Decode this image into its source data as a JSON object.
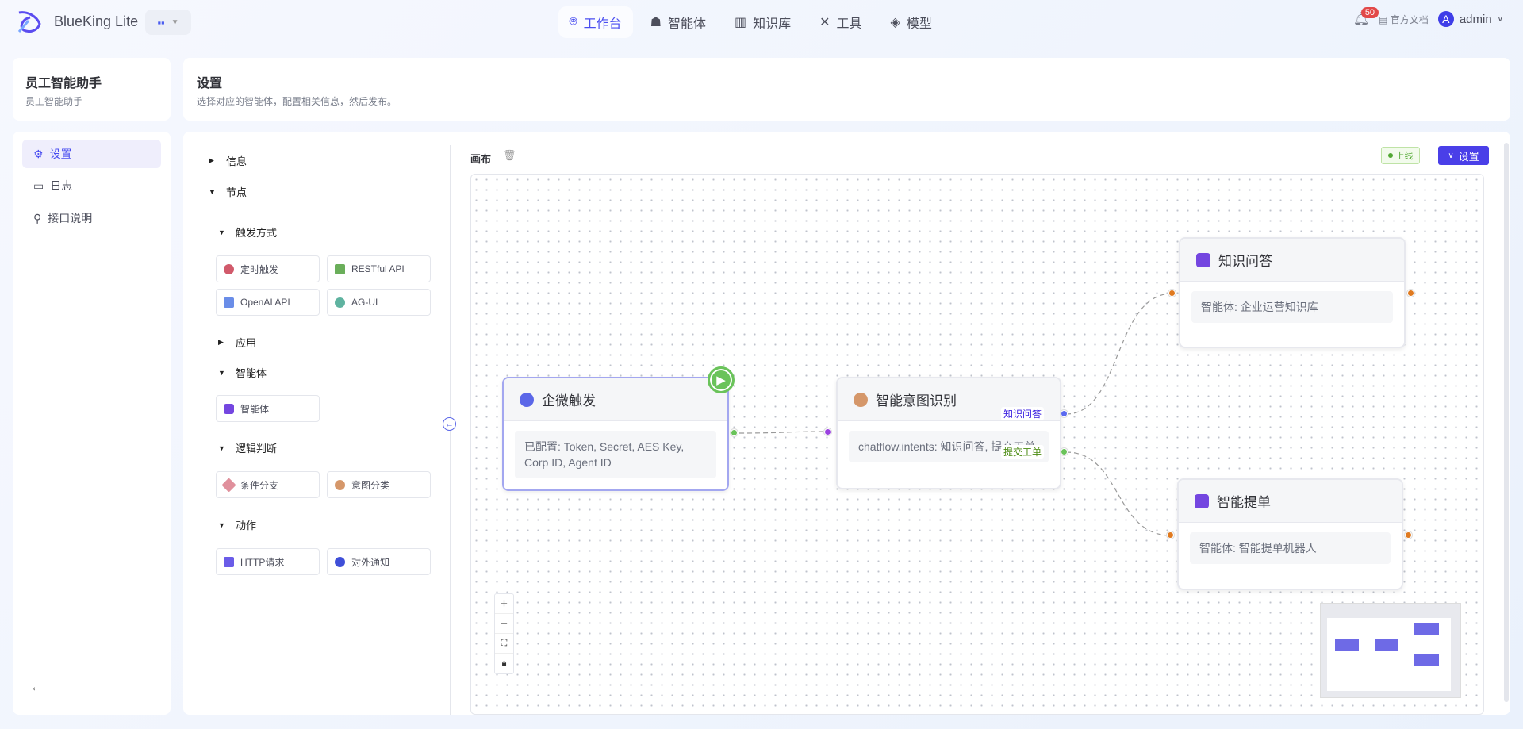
{
  "header": {
    "brand": "BlueKing Lite",
    "nav": [
      {
        "label": "工作台",
        "icon": "robot-icon",
        "active": true
      },
      {
        "label": "智能体",
        "icon": "ghost-icon"
      },
      {
        "label": "知识库",
        "icon": "books-icon"
      },
      {
        "label": "工具",
        "icon": "tools-icon"
      },
      {
        "label": "模型",
        "icon": "layers-icon"
      }
    ],
    "notifications": "50",
    "docs": "官方文档",
    "user": "admin",
    "avatar_letter": "A"
  },
  "app": {
    "title": "员工智能助手",
    "subtitle": "员工智能助手"
  },
  "page": {
    "title": "设置",
    "description": "选择对应的智能体，配置相关信息，然后发布。"
  },
  "sidebar": {
    "items": [
      {
        "label": "设置",
        "active": true
      },
      {
        "label": "日志"
      },
      {
        "label": "接口说明"
      }
    ]
  },
  "panel": {
    "info": "信息",
    "nodes": "节点",
    "groups": {
      "trigger": "触发方式",
      "app": "应用",
      "agent": "智能体",
      "logic": "逻辑判断",
      "action": "动作"
    },
    "items": {
      "timer": "定时触发",
      "restful": "RESTful API",
      "openai": "OpenAI API",
      "agui": "AG-UI",
      "agent": "智能体",
      "condition": "条件分支",
      "intent": "意图分类",
      "http": "HTTP请求",
      "notify": "对外通知"
    }
  },
  "canvas": {
    "label": "画布",
    "status": "上线",
    "status_color": "#52a834",
    "settings": "设置",
    "accent": "#4a4ef0",
    "nodes": [
      {
        "title": "企微触发",
        "body": "已配置: Token, Secret, AES Key, Corp ID, Agent ID"
      },
      {
        "title": "智能意图识别",
        "body": "chatflow.intents: 知识问答, 提交工单",
        "branches": [
          "知识问答",
          "提交工单"
        ]
      },
      {
        "title": "知识问答",
        "body": "智能体: 企业运营知识库"
      },
      {
        "title": "智能提单",
        "body": "智能体: 智能提单机器人"
      }
    ],
    "zoom": {
      "in": "+",
      "out": "−"
    }
  }
}
